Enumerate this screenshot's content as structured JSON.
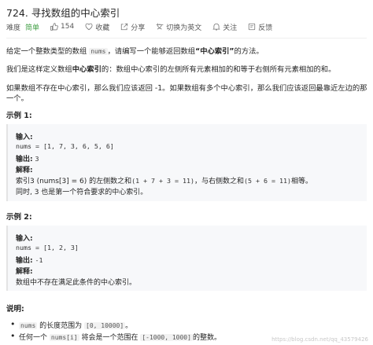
{
  "title": "724. 寻找数组的中心索引",
  "meta": {
    "difficulty_label": "难度",
    "difficulty": "简单",
    "likes": "154",
    "favorite": "收藏",
    "share": "分享",
    "switch_lang": "切换为英文",
    "follow": "关注",
    "feedback": "反馈"
  },
  "desc": {
    "p1": [
      "给定一个整数类型的数组 ",
      "nums",
      "，请编写一个能够返回数组",
      "“中心索引”",
      "的方法。"
    ],
    "p2": [
      "我们是这样定义数组",
      "中心索引",
      "的：数组中心索引的左侧所有元素相加的和等于右侧所有元素相加的和。"
    ],
    "p3_line1": "如果数组不存在中心索引，那么我们应该返回 -1。如果数组有多个中心索引，那么我们应该返回最靠近左边的那",
    "p3_line2": "一个。"
  },
  "examples": [
    {
      "heading": "示例 1:",
      "input_label": "输入:",
      "input": "nums = [1, 7, 3, 6, 5, 6]",
      "output_label": "输出:",
      "output": "3",
      "explain_label": "解释:",
      "explain_1": [
        "索引3 (nums[3] = 6) 的左侧数之和",
        "(1 + 7 + 3 = 11)",
        "，与右侧数之和",
        "(5 + 6 = 11)",
        "相等。"
      ],
      "explain_2": "同时, 3 也是第一个符合要求的中心索引。"
    },
    {
      "heading": "示例 2:",
      "input_label": "输入:",
      "input": "nums = [1, 2, 3]",
      "output_label": "输出:",
      "output": "-1",
      "explain_label": "解释:",
      "explain_1": "数组中不存在满足此条件的中心索引。"
    }
  ],
  "notes": {
    "heading": "说明:",
    "b1": [
      "nums",
      " 的长度范围为 ",
      "[0, 10000]",
      "。"
    ],
    "b2": [
      "任何一个 ",
      "nums[i]",
      " 将会是一个范围在 ",
      "[-1000, 1000]",
      "的整数。"
    ]
  },
  "watermark": "https://blog.csdn.net/qq_43579426"
}
